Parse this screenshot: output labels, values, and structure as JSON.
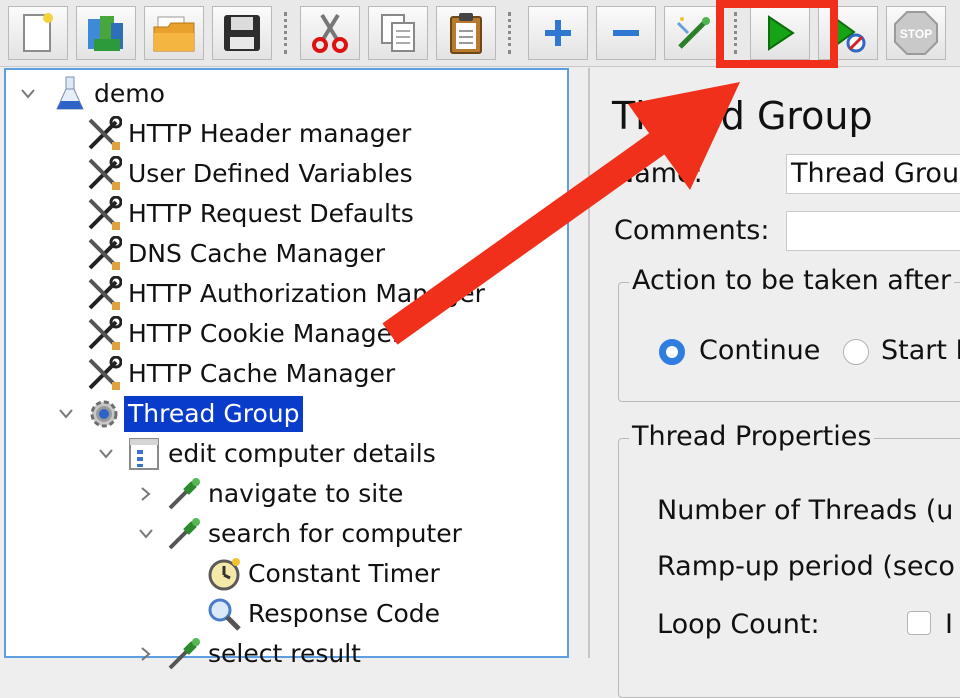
{
  "toolbar": {
    "buttons": [
      {
        "name": "new-button",
        "icon": "new-file-icon"
      },
      {
        "name": "templates-button",
        "icon": "templates-icon"
      },
      {
        "name": "open-button",
        "icon": "open-folder-icon"
      },
      {
        "name": "save-button",
        "icon": "save-disk-icon"
      },
      {
        "name": "cut-button",
        "icon": "scissors-icon"
      },
      {
        "name": "copy-button",
        "icon": "copy-icon"
      },
      {
        "name": "paste-button",
        "icon": "clipboard-icon"
      },
      {
        "name": "expand-all-button",
        "icon": "plus-icon"
      },
      {
        "name": "collapse-all-button",
        "icon": "minus-icon"
      },
      {
        "name": "toggle-button",
        "icon": "wand-icon"
      },
      {
        "name": "start-button",
        "icon": "play-icon"
      },
      {
        "name": "start-no-pauses-button",
        "icon": "play-no-timers-icon"
      },
      {
        "name": "stop-button",
        "icon": "stop-icon",
        "label": "STOP"
      }
    ]
  },
  "tree": {
    "items": [
      {
        "label": "demo",
        "icon": "flask-icon",
        "chevron": "expanded"
      },
      {
        "label": "HTTP Header manager",
        "icon": "tools-icon"
      },
      {
        "label": "User Defined Variables",
        "icon": "tools-icon"
      },
      {
        "label": "HTTP Request Defaults",
        "icon": "tools-icon"
      },
      {
        "label": "DNS Cache Manager",
        "icon": "tools-icon"
      },
      {
        "label": "HTTP Authorization Manager",
        "icon": "tools-icon"
      },
      {
        "label": "HTTP Cookie Manager",
        "icon": "tools-icon"
      },
      {
        "label": "HTTP Cache Manager",
        "icon": "tools-icon"
      },
      {
        "label": "Thread Group",
        "icon": "gear-icon",
        "chevron": "expanded",
        "selected": true
      },
      {
        "label": "edit computer details",
        "icon": "controller-icon",
        "chevron": "expanded"
      },
      {
        "label": "navigate to site",
        "icon": "pipette-icon",
        "chevron": "collapsed"
      },
      {
        "label": "search for computer",
        "icon": "pipette-icon",
        "chevron": "expanded"
      },
      {
        "label": "Constant Timer",
        "icon": "timer-icon"
      },
      {
        "label": "Response Code",
        "icon": "magnifier-icon"
      },
      {
        "label": "select result",
        "icon": "pipette-icon",
        "chevron": "collapsed"
      }
    ]
  },
  "panel": {
    "title": "Thread Group",
    "name_label": "Name:",
    "name_value": "Thread Grou",
    "comments_label": "Comments:",
    "comments_value": "",
    "action_legend": "Action to be taken after",
    "radio_continue": "Continue",
    "radio_start_next": "Start N",
    "thread_props_legend": "Thread Properties",
    "num_threads_label": "Number of Threads (u",
    "ramp_up_label": "Ramp-up period (seco",
    "loop_count_label": "Loop Count:",
    "infinite_partial": "I"
  },
  "colors": {
    "selection": "#0a3ccc",
    "annotation": "#f0301a",
    "tree_border": "#5d9fe0",
    "radio_accent": "#2f7de1"
  }
}
